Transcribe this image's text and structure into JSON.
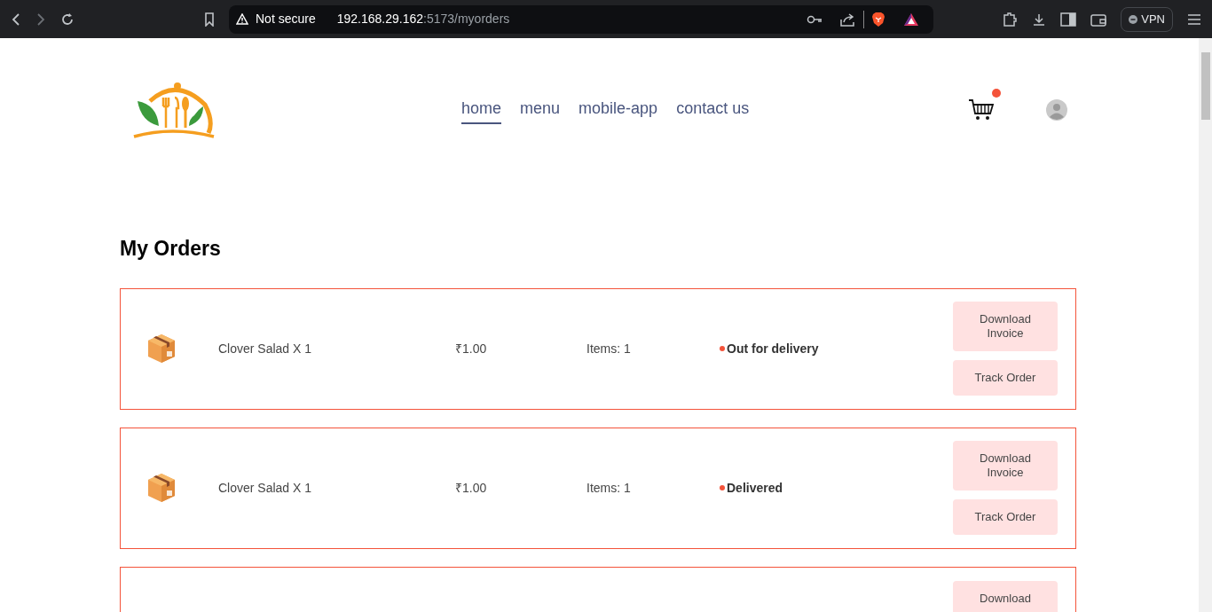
{
  "browser": {
    "security": "Not secure",
    "url_host": "192.168.29.162",
    "url_rest": ":5173/myorders",
    "vpn": "VPN"
  },
  "nav": [
    {
      "label": "home",
      "selected": true
    },
    {
      "label": "menu",
      "selected": false
    },
    {
      "label": "mobile-app",
      "selected": false
    },
    {
      "label": "contact us",
      "selected": false
    }
  ],
  "cart": {
    "has_items": true
  },
  "title": "My Orders",
  "orders": [
    {
      "item": "Clover Salad X 1",
      "price": "₹1.00",
      "count": "Items: 1",
      "status": "Out for delivery",
      "download": "Download Invoice",
      "track": "Track Order"
    },
    {
      "item": "Clover Salad X 1",
      "price": "₹1.00",
      "count": "Items: 1",
      "status": "Delivered",
      "download": "Download Invoice",
      "track": "Track Order"
    },
    {
      "download": "Download"
    }
  ]
}
